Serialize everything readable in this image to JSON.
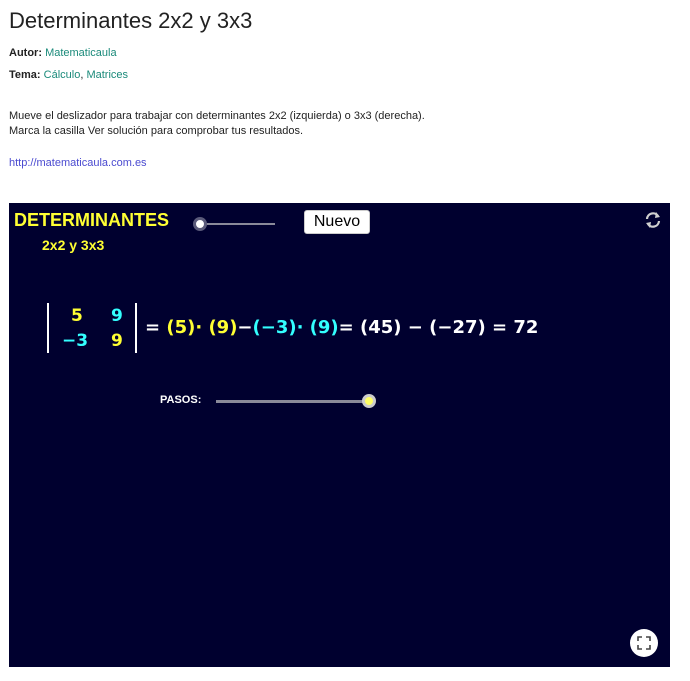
{
  "page": {
    "title": "Determinantes 2x2 y 3x3",
    "author_label": "Autor:",
    "author_name": "Matematicaula",
    "topic_label": "Tema:",
    "topic_1": "Cálculo",
    "topic_separator": ",",
    "topic_2": "Matrices",
    "description_line1": "Mueve el deslizador para trabajar con determinantes 2x2 (izquierda) o 3x3 (derecha).",
    "description_line2": "Marca la casilla Ver solución para comprobar tus resultados.",
    "site_url": "http://matematicaula.com.es"
  },
  "applet": {
    "title": "DETERMINANTES",
    "subtitle": "2x2 y 3x3",
    "new_button": "Nuevo",
    "matrix": {
      "a11": "5",
      "a12": "9",
      "a21": "−3",
      "a22": "9"
    },
    "formula": {
      "eq1": "= ",
      "t1": "(5)· (9)",
      "minus": "−",
      "t2": "(−3)· (9)",
      "rest": "= (45) − (−27) = 72"
    },
    "steps_label": "PASOS:",
    "steps_slider_value": 1.0,
    "mode_slider_value": 0.0,
    "colors": {
      "background": "#00002f",
      "yellow": "#ffff33",
      "cyan": "#33ffff",
      "link": "#1a8a7a"
    },
    "icons": {
      "refresh": "refresh-icon",
      "fullscreen": "fullscreen-icon"
    }
  }
}
